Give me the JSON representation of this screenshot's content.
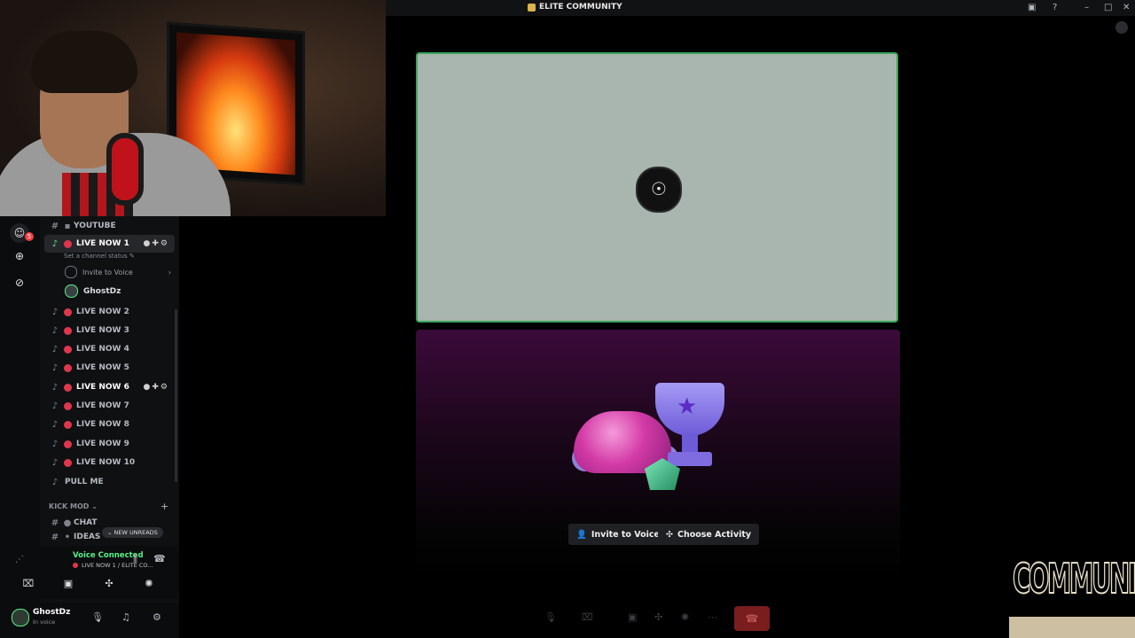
{
  "window": {
    "title": "ELITE COMMUNITY",
    "controls": {
      "minimize": "–",
      "maximize": "□",
      "close": "✕"
    }
  },
  "rail": {
    "badge": "5"
  },
  "channels": {
    "youtube": "YOUTUBE",
    "items": [
      {
        "label": "LIVE NOW 1",
        "status": "Set a channel status ✎"
      },
      {
        "label": "LIVE NOW 2"
      },
      {
        "label": "LIVE NOW 3"
      },
      {
        "label": "LIVE NOW 4"
      },
      {
        "label": "LIVE NOW 5"
      },
      {
        "label": "LIVE NOW 6"
      },
      {
        "label": "LIVE NOW 7"
      },
      {
        "label": "LIVE NOW 8"
      },
      {
        "label": "LIVE NOW 9"
      },
      {
        "label": "LIVE NOW 10"
      }
    ],
    "invite_row": "Invite to Voice",
    "member": "GhostDz",
    "pull_me": "PULL ME",
    "category": "KICK MOD",
    "chat": "CHAT",
    "ideas": "IDEAS",
    "new_unreads": "NEW UNREADS"
  },
  "voice": {
    "status": "Voice Connected",
    "channel": "LIVE NOW 1 / ELITE CO..."
  },
  "user": {
    "name": "GhostDz",
    "status": "In voice"
  },
  "stage": {
    "invite_button": "Invite to Voice",
    "activity_button": "Choose Activity"
  },
  "watermark": "COMMUNITY"
}
